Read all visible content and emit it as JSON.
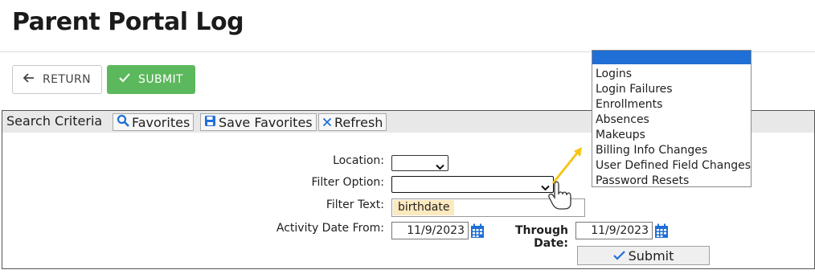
{
  "page": {
    "title": "Parent Portal Log"
  },
  "toolbar": {
    "return_label": "RETURN",
    "submit_label": "SUBMIT"
  },
  "search": {
    "heading": "Search Criteria",
    "favorites_label": "Favorites",
    "save_favorites_label": "Save Favorites",
    "refresh_label": "Refresh"
  },
  "form": {
    "location_label": "Location:",
    "location_value": "",
    "filter_option_label": "Filter Option:",
    "filter_option_value": "",
    "filter_text_label": "Filter Text:",
    "filter_text_value": "birthdate",
    "date_from_label": "Activity Date From:",
    "date_from_value": "11/9/2023",
    "through_label": "Through Date:",
    "through_value": "11/9/2023",
    "submit_label": "Submit"
  },
  "filter_dropdown": {
    "options": [
      "",
      "Logins",
      "Login Failures",
      "Enrollments",
      "Absences",
      "Makeups",
      "Billing Info Changes",
      "User Defined Field Changes",
      "Password Resets"
    ],
    "selected_index": 0
  },
  "colors": {
    "submit_green": "#5cb85c",
    "accent_blue": "#1f6fd6",
    "arrow_yellow": "#f5c518",
    "highlight": "#fde9bf"
  }
}
